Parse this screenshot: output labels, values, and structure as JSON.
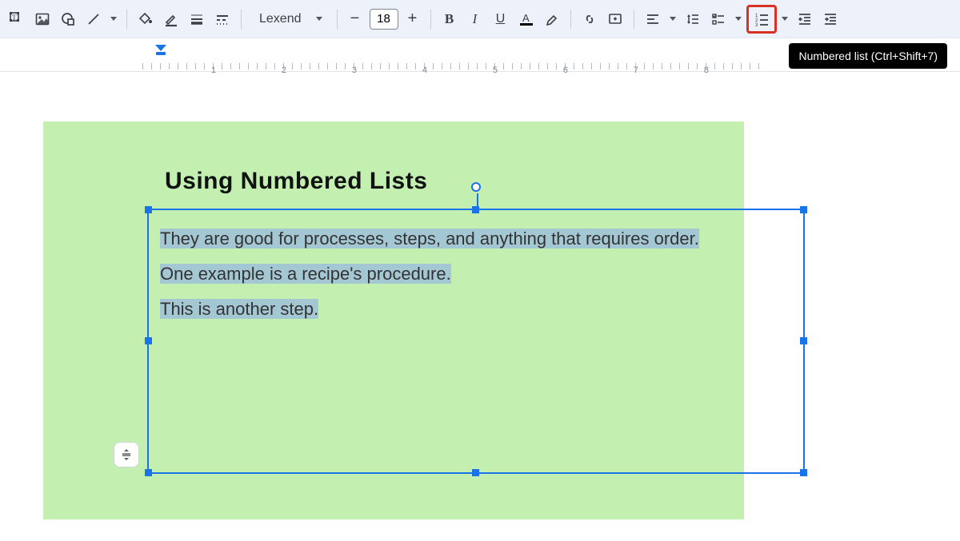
{
  "toolbar": {
    "font_name": "Lexend",
    "font_size": "18",
    "tooltip": "Numbered list (Ctrl+Shift+7)"
  },
  "ruler": {
    "marks": [
      "1",
      "2",
      "3",
      "4",
      "5",
      "6",
      "7",
      "8"
    ]
  },
  "slide": {
    "title": "Using Numbered Lists",
    "lines": [
      "They are good for processes, steps, and anything that requires order.",
      "One example is a recipe's procedure.",
      "This is another step."
    ]
  }
}
